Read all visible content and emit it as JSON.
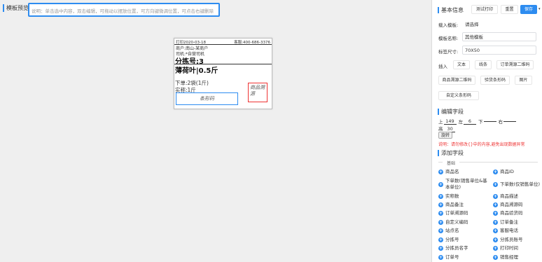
{
  "header": {
    "title": "模板预览",
    "hint": "说明：单击选中内容，双击编辑，可拖动以摆放位置，可方向键微调位置，可点击右键删除"
  },
  "label": {
    "print_time": "打印2020-03-18",
    "hotline": "客服:400-686-3376",
    "merchant": "商户:南山-某商户",
    "driver": "司机:*自营司机",
    "sort_no": "分拣号:3",
    "product": "薄荷叶|0.5斤",
    "order_qty": "下单:2袋(1斤)",
    "actual_qty": "实称:1斤",
    "barcode": "条形码",
    "qrcode": "商品溯源"
  },
  "basic": {
    "title": "基本信息",
    "test_print": "测试打印",
    "reset": "重置",
    "save": "保存",
    "load_label": "载入模板:",
    "load_value": "请选择",
    "name_label": "模板名称:",
    "name_value": "其他模板",
    "size_label": "标签尺寸:",
    "size_value": "70X50",
    "insert_label": "插入",
    "btn_text": "文本",
    "btn_line": "线条",
    "btn_order_qr": "订单溯源二维码",
    "btn_goods_qr": "商品溯源二维码",
    "btn_verify_bar": "验货条形码",
    "btn_image": "图片",
    "btn_custom_bar": "自定义条形码"
  },
  "edit": {
    "title": "编辑字段",
    "top_label": "上",
    "top_val": "149",
    "left_label": "左",
    "left_val": "6",
    "bottom_label": "下",
    "right_label": "右",
    "height_label": "高",
    "height_val": "30",
    "rotate": "旋转",
    "note": "说明：请勿修改{}中的内容,避免出现数据异常"
  },
  "add": {
    "title": "添加字段",
    "group": "基础",
    "fields_left": [
      "商品名",
      "下单数(销售单位&基本单位)",
      "实称数",
      "商品备注",
      "订单溯源码",
      "自定义编码",
      "站点名",
      "分拣号",
      "分拣员名字",
      "订单号"
    ],
    "fields_right": [
      "商品ID",
      "下单数(仅销售单位)",
      "商品描述",
      "商品溯源码",
      "商品验货码",
      "订单备注",
      "客服电话",
      "分拣员账号",
      "打印时间",
      "销售经理"
    ]
  }
}
